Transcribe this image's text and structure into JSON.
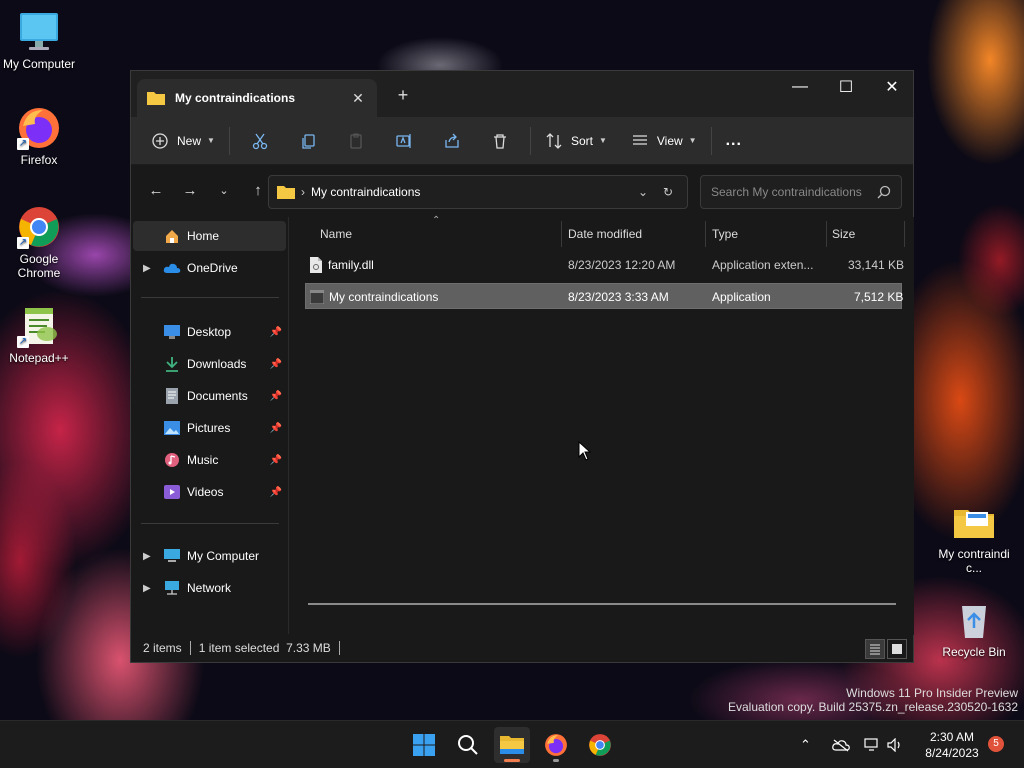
{
  "desktop": {
    "icons": [
      {
        "label": "My Computer",
        "icon": "monitor-icon"
      },
      {
        "label": "Firefox",
        "icon": "firefox-icon"
      },
      {
        "label": "Google Chrome",
        "icon": "chrome-icon"
      },
      {
        "label": "Notepad++",
        "icon": "notepadpp-icon"
      },
      {
        "label": "My contraindic...",
        "icon": "folder-icon"
      },
      {
        "label": "Recycle Bin",
        "icon": "recycle-bin-icon"
      }
    ],
    "watermark": {
      "line1": "Windows 11 Pro Insider Preview",
      "line2": "Evaluation copy. Build 25375.zn_release.230520-1632"
    }
  },
  "window": {
    "tab_title": "My contraindications",
    "new_tab": "+",
    "toolbar": {
      "new_label": "New",
      "sort_label": "Sort",
      "view_label": "View",
      "more_label": "..."
    },
    "address": {
      "path": "My contraindications",
      "search_placeholder": "Search My contraindications"
    },
    "sidebar": {
      "home": "Home",
      "onedrive": "OneDrive",
      "quick_access": [
        {
          "label": "Desktop",
          "icon": "desktop-icon",
          "color": "#3a8ee6"
        },
        {
          "label": "Downloads",
          "icon": "download-icon",
          "color": "#3fb37f"
        },
        {
          "label": "Documents",
          "icon": "documents-icon",
          "color": "#9aa3ad"
        },
        {
          "label": "Pictures",
          "icon": "pictures-icon",
          "color": "#3a8ee6"
        },
        {
          "label": "Music",
          "icon": "music-icon",
          "color": "#e0607e"
        },
        {
          "label": "Videos",
          "icon": "videos-icon",
          "color": "#8a5cd8"
        }
      ],
      "my_computer": "My Computer",
      "network": "Network"
    },
    "columns": {
      "name": "Name",
      "date": "Date modified",
      "type": "Type",
      "size": "Size"
    },
    "files": [
      {
        "name": "family.dll",
        "date": "8/23/2023 12:20 AM",
        "type": "Application exten...",
        "size": "33,141 KB",
        "selected": false
      },
      {
        "name": "My contraindications",
        "date": "8/23/2023 3:33 AM",
        "type": "Application",
        "size": "7,512 KB",
        "selected": true
      }
    ],
    "status": {
      "items": "2 items",
      "selection": "1 item selected  7.33 MB"
    }
  },
  "taskbar": {
    "time": "2:30 AM",
    "date": "8/24/2023",
    "notification_count": "5"
  },
  "colors": {
    "accent": "#f27e4f",
    "folder": "#f5c843",
    "selected_row": "#606060"
  }
}
